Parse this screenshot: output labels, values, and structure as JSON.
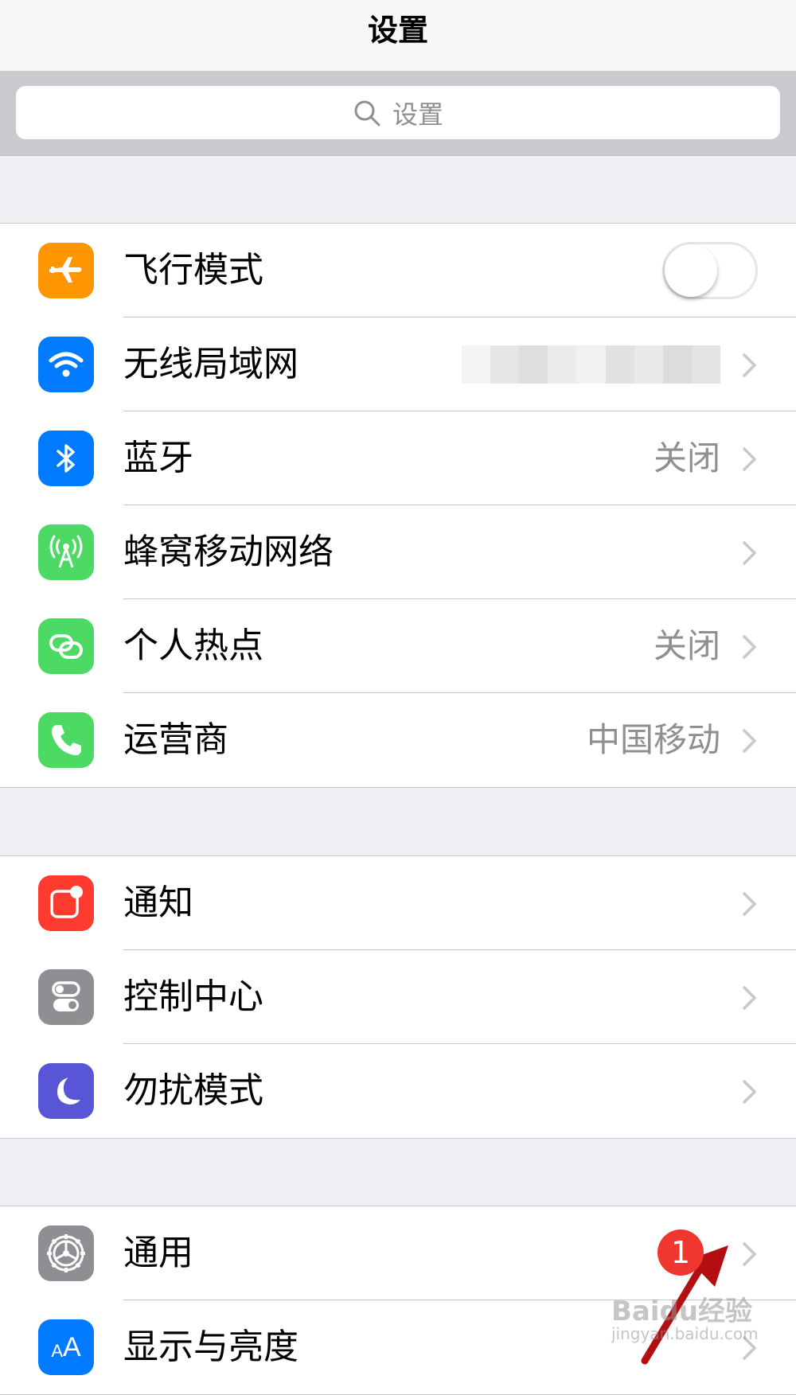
{
  "nav": {
    "title": "设置"
  },
  "search": {
    "placeholder": "设置"
  },
  "group1": [
    {
      "label": "飞行模式",
      "icon": "airplane-icon",
      "color": "#ff9500",
      "accessory": "toggle",
      "toggle_on": false
    },
    {
      "label": "无线局域网",
      "icon": "wifi-icon",
      "color": "#007aff",
      "accessory": "chevron",
      "value_blurred": true
    },
    {
      "label": "蓝牙",
      "icon": "bluetooth-icon",
      "color": "#007aff",
      "value": "关闭",
      "accessory": "chevron"
    },
    {
      "label": "蜂窝移动网络",
      "icon": "cellular-antenna-icon",
      "color": "#4cd964",
      "accessory": "chevron"
    },
    {
      "label": "个人热点",
      "icon": "hotspot-chain-icon",
      "color": "#4cd964",
      "value": "关闭",
      "accessory": "chevron"
    },
    {
      "label": "运营商",
      "icon": "phone-icon",
      "color": "#4cd964",
      "value": "中国移动",
      "accessory": "chevron"
    }
  ],
  "group2": [
    {
      "label": "通知",
      "icon": "notification-icon",
      "color": "#ff3b30",
      "accessory": "chevron"
    },
    {
      "label": "控制中心",
      "icon": "control-center-icon",
      "color": "#8e8e93",
      "accessory": "chevron"
    },
    {
      "label": "勿扰模式",
      "icon": "moon-icon",
      "color": "#5856d6",
      "accessory": "chevron"
    }
  ],
  "group3": [
    {
      "label": "通用",
      "icon": "gear-icon",
      "color": "#8e8e93",
      "accessory": "chevron"
    },
    {
      "label": "显示与亮度",
      "icon": "text-size-icon",
      "color": "#007aff",
      "accessory": "chevron"
    }
  ],
  "annotation": {
    "badge_number": "1",
    "badge_color": "#f0372f",
    "arrow_color": "#b30f12"
  },
  "watermark": {
    "text": "Baidu经验",
    "subtext": "jingyan.baidu.com"
  }
}
